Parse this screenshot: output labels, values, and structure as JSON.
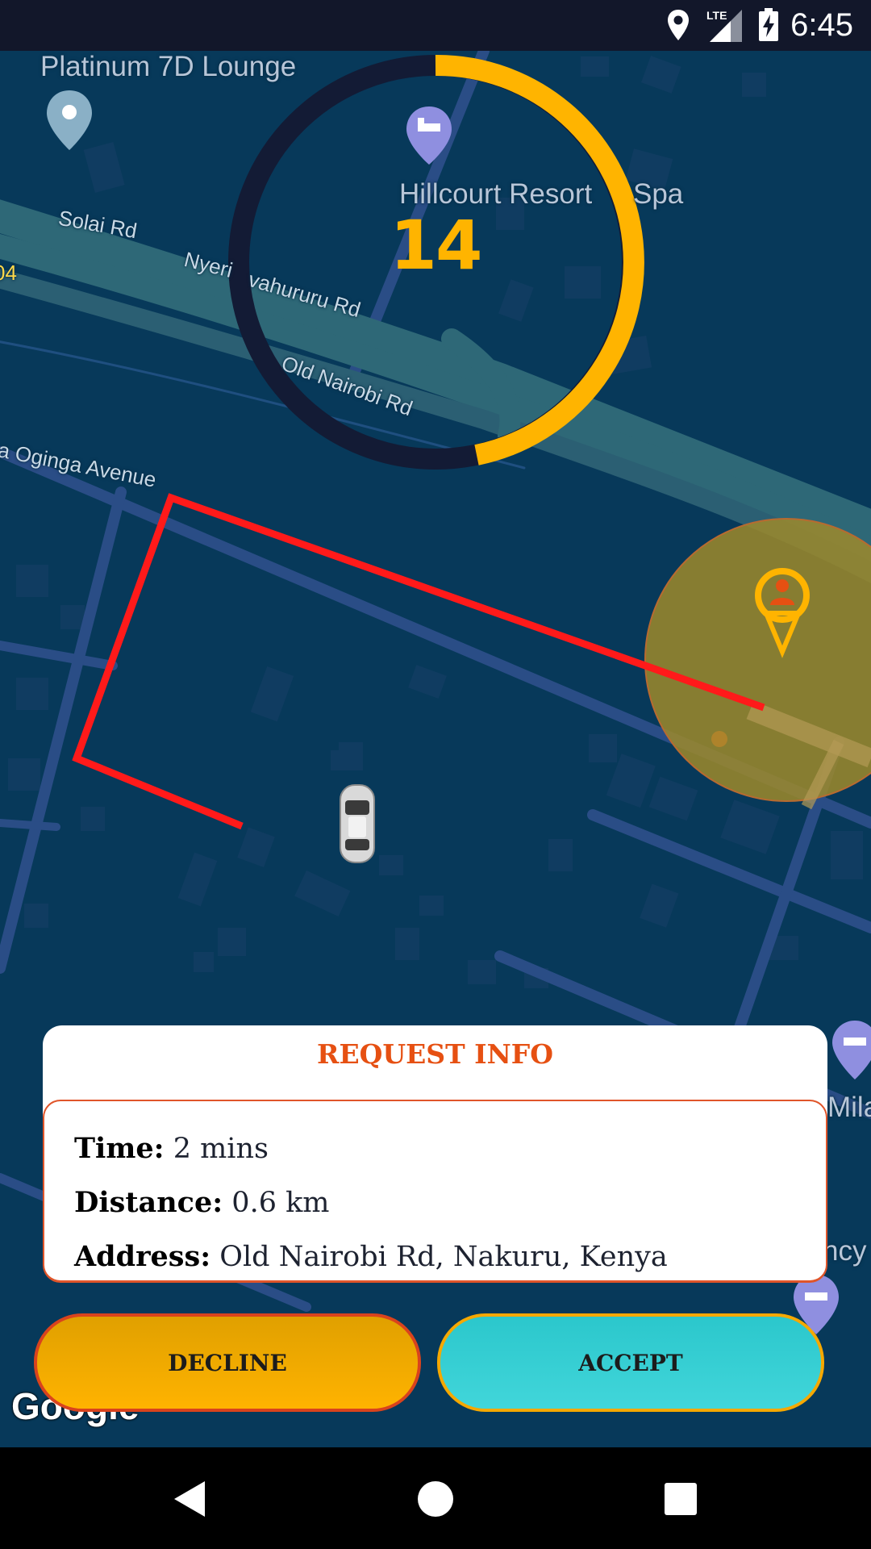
{
  "status_bar": {
    "time": "6:45",
    "icons": [
      "location-icon",
      "lte-signal-icon",
      "battery-charging-icon"
    ],
    "network_label": "LTE"
  },
  "map": {
    "poi_labels": {
      "lounge": "Platinum 7D Lounge",
      "resort": "Hillcourt Resort",
      "spa": "Spa",
      "right_edge_1": "Mila",
      "right_edge_2": "ncy"
    },
    "road_labels": {
      "solai": "Solai Rd",
      "nyeri": "Nyeri",
      "nyahururu": "vahururu Rd",
      "old_nairobi": "Old Nairobi Rd",
      "oginga": "a Oginga Avenue",
      "edge_number": "04"
    },
    "attribution": "Google"
  },
  "timer": {
    "value": "14",
    "progress_fraction": 0.42,
    "colors": {
      "progress": "#ffb400",
      "track": "#131b35"
    }
  },
  "request_info": {
    "title": "REQUEST INFO",
    "time_label": "Time:",
    "time_value": "2 mins",
    "distance_label": "Distance:",
    "distance_value": "0.6 km",
    "address_label": "Address:",
    "address_value": "Old Nairobi Rd, Nakuru, Kenya"
  },
  "actions": {
    "decline_label": "DECLINE",
    "accept_label": "ACCEPT"
  },
  "colors": {
    "accent_orange": "#e65012",
    "route_red": "#ff1a1a",
    "decline_yellow": "#ffb300",
    "accept_teal": "#41d6da"
  },
  "nav_bar": {
    "icons": [
      "back-icon",
      "home-icon",
      "recents-icon"
    ]
  }
}
